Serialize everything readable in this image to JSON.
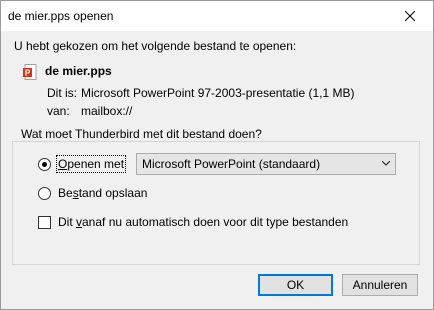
{
  "window": {
    "title": "de mier.pps openen",
    "close_label": "Sluiten"
  },
  "intro": "U hebt gekozen om het volgende bestand te openen:",
  "file": {
    "name": "de mier.pps",
    "type_label": "Dit is:",
    "type_value": "Microsoft PowerPoint 97-2003-presentatie (1,1 MB)",
    "from_label": "van:",
    "from_value": "mailbox://"
  },
  "action_group": {
    "legend": "Wat moet Thunderbird met dit bestand doen?",
    "open_with": {
      "pre": "",
      "acc": "O",
      "post": "penen met",
      "selected": true
    },
    "app_select": {
      "value": "Microsoft PowerPoint (standaard)"
    },
    "save_file": {
      "pre": "Be",
      "acc": "s",
      "post": "tand opslaan",
      "selected": false
    },
    "auto": {
      "pre": "Dit ",
      "acc": "v",
      "post": "anaf nu automatisch doen voor dit type bestanden",
      "checked": false
    }
  },
  "buttons": {
    "ok": "OK",
    "cancel": "Annuleren"
  },
  "icons": {
    "close": "close-icon",
    "file": "powerpoint-file-icon",
    "dropdown": "chevron-down-icon"
  },
  "colors": {
    "focus_border": "#0078d7",
    "window_bg": "#f0f0f0",
    "titlebar_bg": "#ffffff"
  }
}
